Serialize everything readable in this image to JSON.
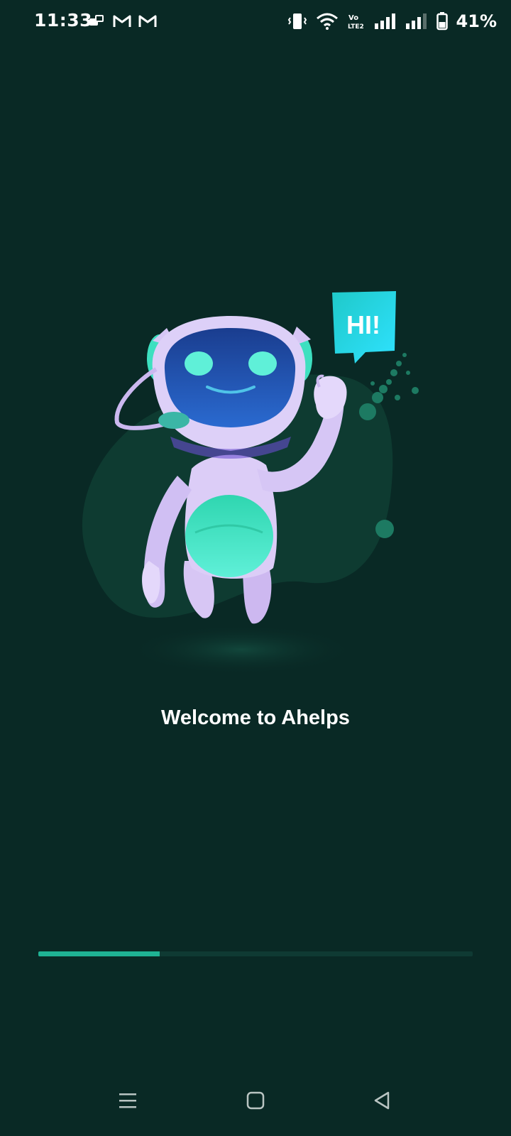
{
  "status_bar": {
    "time": "11:33",
    "battery_percent": "41%",
    "icons": [
      "notification-icon",
      "gmail-icon",
      "gmail-icon",
      "vibrate-icon",
      "wifi-icon",
      "volte-icon",
      "signal-icon",
      "signal-icon",
      "battery-icon"
    ]
  },
  "illustration": {
    "speech_bubble_text": "HI!",
    "colors": {
      "background": "#092925",
      "blob": "#0f3d33",
      "robot_body": "#d8c9f5",
      "visor": "#1e4fa8",
      "accent": "#3de0c0",
      "bubble": "#27d9e8"
    }
  },
  "welcome": {
    "title": "Welcome to Ahelps"
  },
  "progress": {
    "fraction": 0.28,
    "color": "#1fb294"
  },
  "nav_bar": {
    "buttons": [
      "recent-apps-icon",
      "home-icon",
      "back-icon"
    ]
  }
}
